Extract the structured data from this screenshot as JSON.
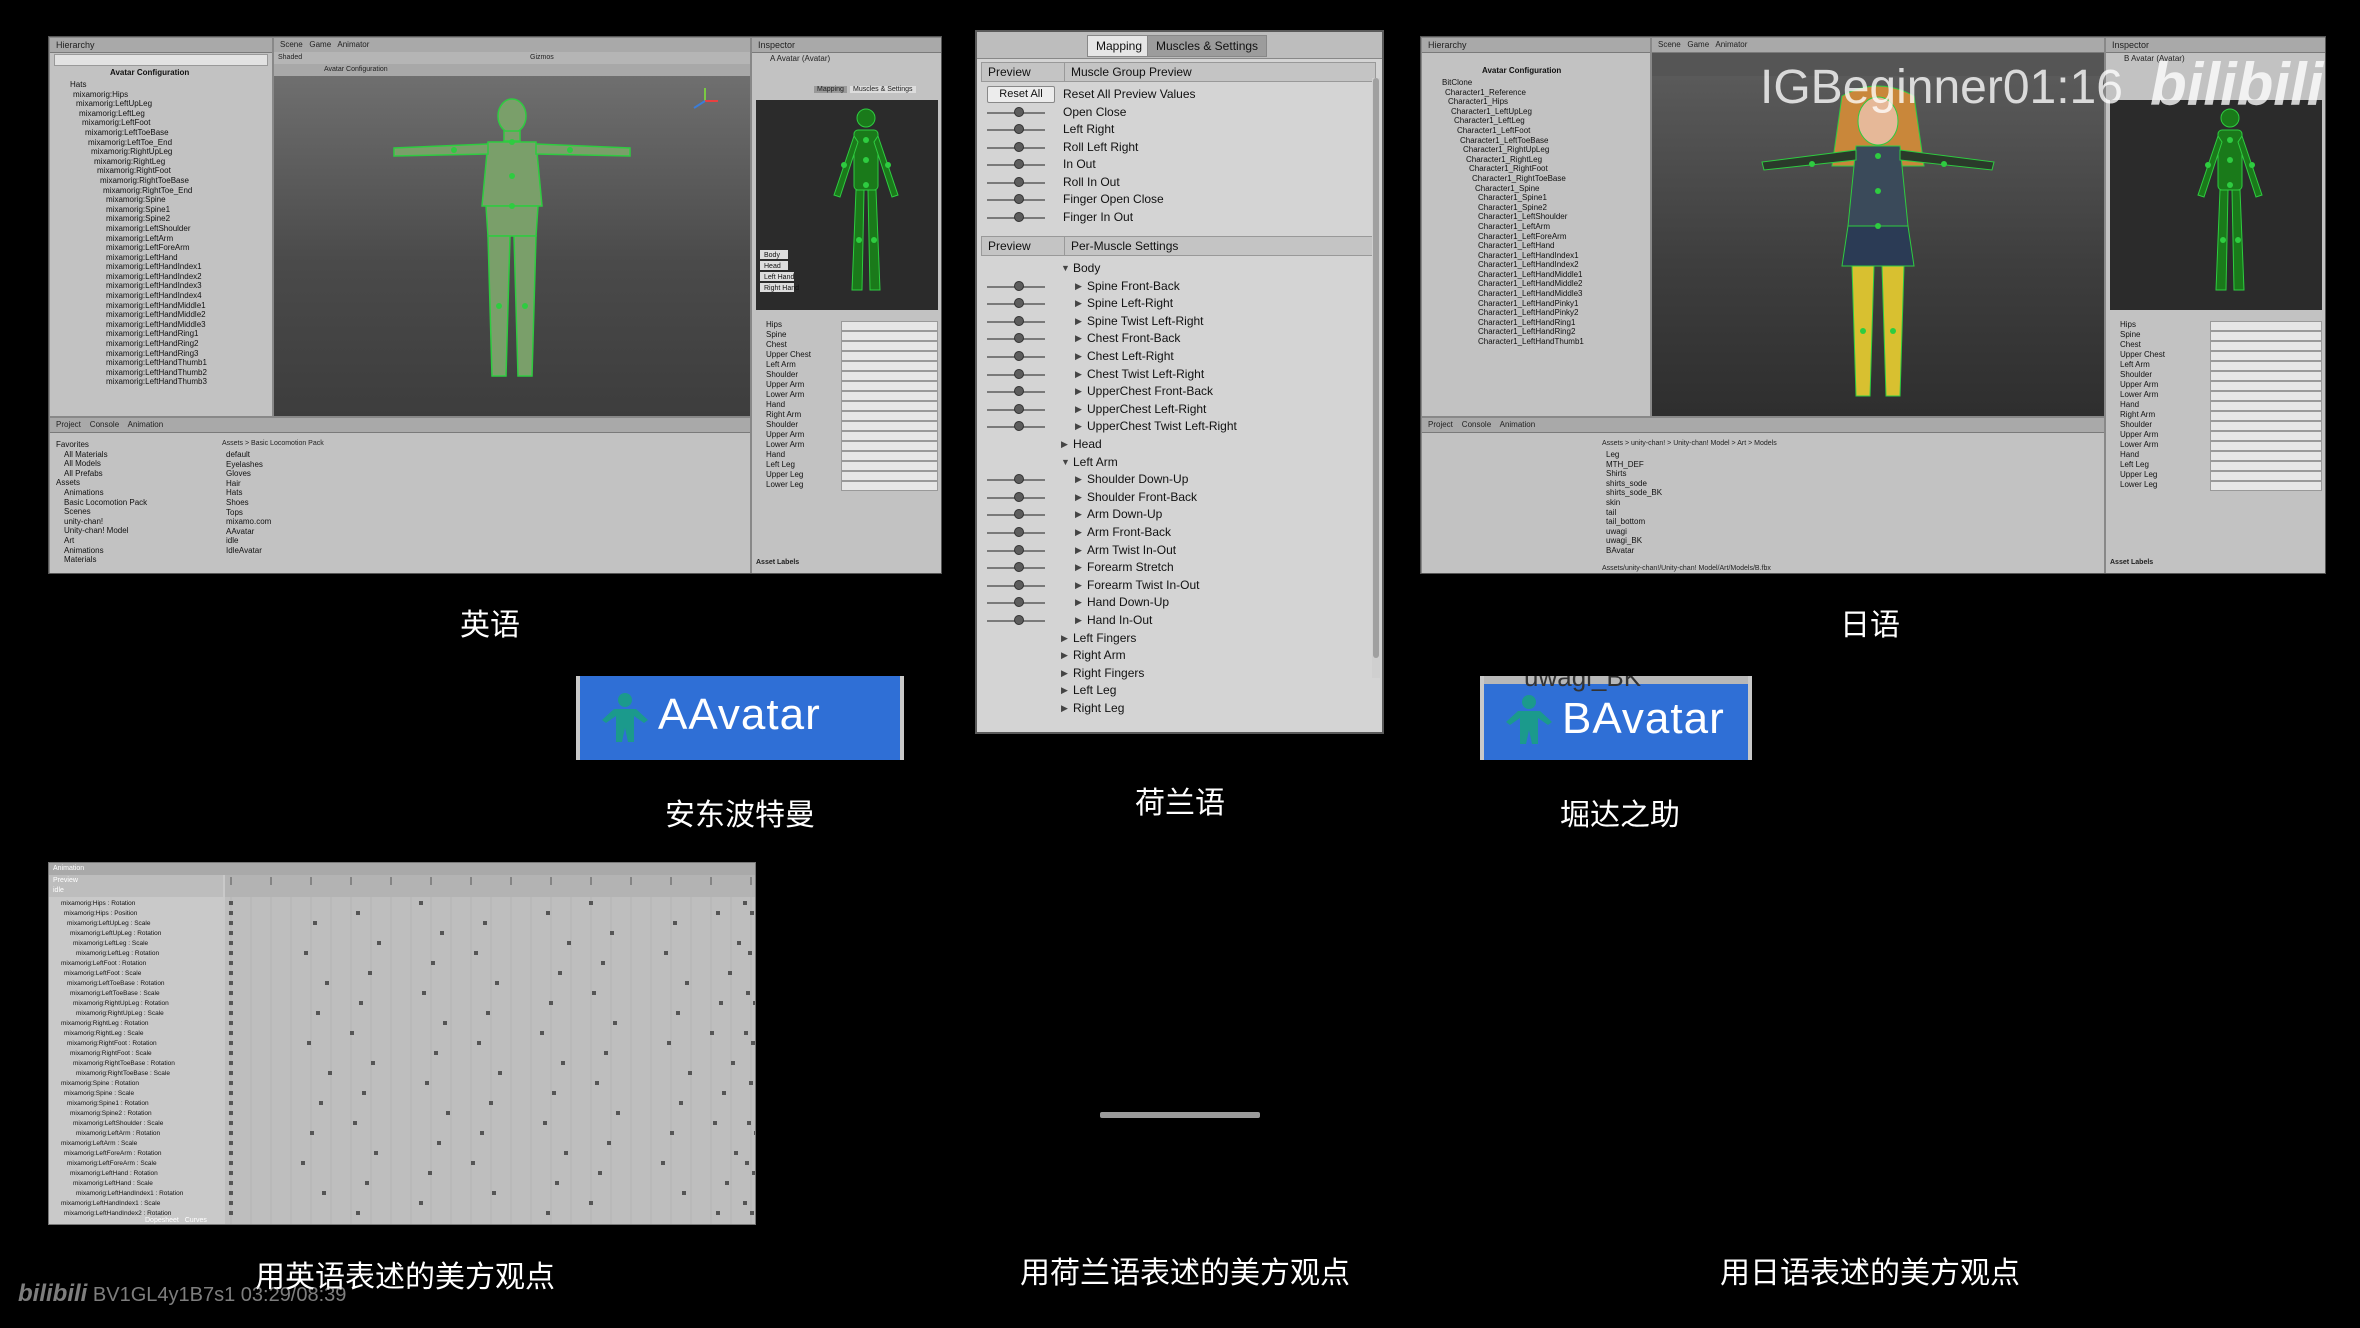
{
  "captions": {
    "english": "英语",
    "japanese": "日语",
    "dutch": "荷兰语",
    "andong": "安东波特曼",
    "horida": "堀达之助",
    "english_view": "用英语表述的美方观点",
    "dutch_view": "用荷兰语表述的美方观点",
    "japanese_view": "用日语表述的美方观点"
  },
  "badges": {
    "a": "AAvatar",
    "b": "BAvatar",
    "b_overlap_text": "uwagi_BK"
  },
  "watermark": {
    "channel": "IGBeginner01:16",
    "logo": "bilibili",
    "footer_logo": "bilibili",
    "footer_id": "BV1GL4y1B7s1 03:29/08:39"
  },
  "left_editor": {
    "tabs": [
      "Hierarchy",
      "Scene",
      "Game",
      "Animator",
      "Inspector"
    ],
    "hierarchy_title": "Avatar Configuration",
    "scene_title": "Avatar Configuration",
    "shading": "Shaded",
    "gizmos": "Gizmos",
    "inspector_title": "A Avatar (Avatar)",
    "hierarchy": [
      "Hats",
      "mixamorig:Hips",
      "mixamorig:LeftUpLeg",
      "mixamorig:LeftLeg",
      "mixamorig:LeftFoot",
      "mixamorig:LeftToeBase",
      "mixamorig:LeftToe_End",
      "mixamorig:RightUpLeg",
      "mixamorig:RightLeg",
      "mixamorig:RightFoot",
      "mixamorig:RightToeBase",
      "mixamorig:RightToe_End",
      "mixamorig:Spine",
      "mixamorig:Spine1",
      "mixamorig:Spine2",
      "mixamorig:LeftShoulder",
      "mixamorig:LeftArm",
      "mixamorig:LeftForeArm",
      "mixamorig:LeftHand",
      "mixamorig:LeftHandIndex1",
      "mixamorig:LeftHandIndex2",
      "mixamorig:LeftHandIndex3",
      "mixamorig:LeftHandIndex4",
      "mixamorig:LeftHandMiddle1",
      "mixamorig:LeftHandMiddle2",
      "mixamorig:LeftHandMiddle3",
      "mixamorig:LeftHandRing1",
      "mixamorig:LeftHandRing2",
      "mixamorig:LeftHandRing3",
      "mixamorig:LeftHandThumb1",
      "mixamorig:LeftHandThumb2",
      "mixamorig:LeftHandThumb3"
    ],
    "inspector_rows": [
      "Hips",
      "Spine",
      "Chest",
      "Upper Chest",
      "Left Arm",
      "Shoulder",
      "Upper Arm",
      "Lower Arm",
      "Hand",
      "Right Arm",
      "Shoulder",
      "Upper Arm",
      "Lower Arm",
      "Hand",
      "Left Leg",
      "Upper Leg",
      "Lower Leg"
    ],
    "project_tabs": [
      "Project",
      "Console",
      "Animation"
    ],
    "project_tree": [
      "Favorites",
      "All Materials",
      "All Models",
      "All Prefabs",
      "Assets",
      "Animations",
      "Basic Locomotion Pack",
      "Scenes",
      "unity-chan!",
      "Unity-chan! Model",
      "Art",
      "Animations",
      "Materials"
    ],
    "project_files": [
      "default",
      "Eyelashes",
      "Gloves",
      "Hair",
      "Hats",
      "Shoes",
      "Tops",
      "mixamo.com",
      "AAvatar",
      "idle",
      "IdleAvatar"
    ],
    "breadcrumb": "Assets > Basic Locomotion Pack",
    "asset_labels": "Asset Labels"
  },
  "right_editor": {
    "tabs": [
      "Hierarchy",
      "Scene",
      "Game",
      "Animator",
      "Inspector"
    ],
    "hierarchy_title": "Avatar Configuration",
    "inspector_title": "B Avatar (Avatar)",
    "hierarchy": [
      "BitClone",
      "Character1_Reference",
      "Character1_Hips",
      "Character1_LeftUpLeg",
      "Character1_LeftLeg",
      "Character1_LeftFoot",
      "Character1_LeftToeBase",
      "Character1_RightUpLeg",
      "Character1_RightLeg",
      "Character1_RightFoot",
      "Character1_RightToeBase",
      "Character1_Spine",
      "Character1_Spine1",
      "Character1_Spine2",
      "Character1_LeftShoulder",
      "Character1_LeftArm",
      "Character1_LeftForeArm",
      "Character1_LeftHand",
      "Character1_LeftHandIndex1",
      "Character1_LeftHandIndex2",
      "Character1_LeftHandMiddle1",
      "Character1_LeftHandMiddle2",
      "Character1_LeftHandMiddle3",
      "Character1_LeftHandPinky1",
      "Character1_LeftHandPinky2",
      "Character1_LeftHandRing1",
      "Character1_LeftHandRing2",
      "Character1_LeftHandThumb1"
    ],
    "inspector_rows": [
      "Hips",
      "Spine",
      "Chest",
      "Upper Chest",
      "Left Arm",
      "Shoulder",
      "Upper Arm",
      "Lower Arm",
      "Hand",
      "Right Arm",
      "Shoulder",
      "Upper Arm",
      "Lower Arm",
      "Hand",
      "Left Leg",
      "Upper Leg",
      "Lower Leg"
    ],
    "project_tabs": [
      "Project",
      "Console",
      "Animation"
    ],
    "breadcrumb": "Assets > unity-chan! > Unity-chan! Model > Art > Models",
    "project_files": [
      "Leg",
      "MTH_DEF",
      "Shirts",
      "shirts_sode",
      "shirts_sode_BK",
      "skin",
      "tail",
      "tail_bottom",
      "uwagi",
      "uwagi_BK",
      "BAvatar"
    ],
    "bottom_path": "Assets/unity-chan!/Unity-chan! Model/Art/Models/B.fbx",
    "asset_labels": "Asset Labels"
  },
  "muscles": {
    "tabs": [
      "Mapping",
      "Muscles & Settings"
    ],
    "active_tab": 1,
    "group_header": {
      "left": "Preview",
      "right": "Muscle Group Preview"
    },
    "reset_all": "Reset All",
    "group_rows": [
      "Reset All Preview Values",
      "Open Close",
      "Left Right",
      "Roll Left Right",
      "In Out",
      "Roll In Out",
      "Finger Open Close",
      "Finger In Out"
    ],
    "per_header": {
      "left": "Preview",
      "right": "Per-Muscle Settings"
    },
    "per_rows": [
      {
        "label": "Body",
        "indent": 0,
        "open": true,
        "slider": false
      },
      {
        "label": "Spine Front-Back",
        "indent": 1,
        "open": false,
        "slider": true
      },
      {
        "label": "Spine Left-Right",
        "indent": 1,
        "open": false,
        "slider": true
      },
      {
        "label": "Spine Twist Left-Right",
        "indent": 1,
        "open": false,
        "slider": true
      },
      {
        "label": "Chest Front-Back",
        "indent": 1,
        "open": false,
        "slider": true
      },
      {
        "label": "Chest Left-Right",
        "indent": 1,
        "open": false,
        "slider": true
      },
      {
        "label": "Chest Twist Left-Right",
        "indent": 1,
        "open": false,
        "slider": true
      },
      {
        "label": "UpperChest Front-Back",
        "indent": 1,
        "open": false,
        "slider": true
      },
      {
        "label": "UpperChest Left-Right",
        "indent": 1,
        "open": false,
        "slider": true
      },
      {
        "label": "UpperChest Twist Left-Right",
        "indent": 1,
        "open": false,
        "slider": true
      },
      {
        "label": "Head",
        "indent": 0,
        "open": false,
        "slider": false
      },
      {
        "label": "Left Arm",
        "indent": 0,
        "open": true,
        "slider": false
      },
      {
        "label": "Shoulder Down-Up",
        "indent": 1,
        "open": false,
        "slider": true
      },
      {
        "label": "Shoulder Front-Back",
        "indent": 1,
        "open": false,
        "slider": true
      },
      {
        "label": "Arm Down-Up",
        "indent": 1,
        "open": false,
        "slider": true
      },
      {
        "label": "Arm Front-Back",
        "indent": 1,
        "open": false,
        "slider": true
      },
      {
        "label": "Arm Twist In-Out",
        "indent": 1,
        "open": false,
        "slider": true
      },
      {
        "label": "Forearm Stretch",
        "indent": 1,
        "open": false,
        "slider": true
      },
      {
        "label": "Forearm Twist In-Out",
        "indent": 1,
        "open": false,
        "slider": true
      },
      {
        "label": "Hand Down-Up",
        "indent": 1,
        "open": false,
        "slider": true
      },
      {
        "label": "Hand In-Out",
        "indent": 1,
        "open": false,
        "slider": true
      },
      {
        "label": "Left Fingers",
        "indent": 0,
        "open": false,
        "slider": false
      },
      {
        "label": "Right Arm",
        "indent": 0,
        "open": false,
        "slider": false
      },
      {
        "label": "Right Fingers",
        "indent": 0,
        "open": false,
        "slider": false
      },
      {
        "label": "Left Leg",
        "indent": 0,
        "open": false,
        "slider": false
      },
      {
        "label": "Right Leg",
        "indent": 0,
        "open": false,
        "slider": false
      }
    ]
  },
  "animation": {
    "title": "Animation",
    "preview": "Preview",
    "samples": "idle",
    "tracks": [
      "mixamorig:Hips : Rotation",
      "mixamorig:Hips : Position",
      "mixamorig:LeftUpLeg : Scale",
      "mixamorig:LeftUpLeg : Rotation",
      "mixamorig:LeftLeg : Scale",
      "mixamorig:LeftLeg : Rotation",
      "mixamorig:LeftFoot : Rotation",
      "mixamorig:LeftFoot : Scale",
      "mixamorig:LeftToeBase : Rotation",
      "mixamorig:LeftToeBase : Scale",
      "mixamorig:RightUpLeg : Rotation",
      "mixamorig:RightUpLeg : Scale",
      "mixamorig:RightLeg : Rotation",
      "mixamorig:RightLeg : Scale",
      "mixamorig:RightFoot : Rotation",
      "mixamorig:RightFoot : Scale",
      "mixamorig:RightToeBase : Rotation",
      "mixamorig:RightToeBase : Scale",
      "mixamorig:Spine : Rotation",
      "mixamorig:Spine : Scale",
      "mixamorig:Spine1 : Rotation",
      "mixamorig:Spine2 : Rotation",
      "mixamorig:LeftShoulder : Scale",
      "mixamorig:LeftArm : Rotation",
      "mixamorig:LeftArm : Scale",
      "mixamorig:LeftForeArm : Rotation",
      "mixamorig:LeftForeArm : Scale",
      "mixamorig:LeftHand : Rotation",
      "mixamorig:LeftHand : Scale",
      "mixamorig:LeftHandIndex1 : Rotation",
      "mixamorig:LeftHandIndex1 : Scale",
      "mixamorig:LeftHandIndex2 : Rotation"
    ],
    "bottom_tabs": [
      "Dopesheet",
      "Curves"
    ]
  }
}
